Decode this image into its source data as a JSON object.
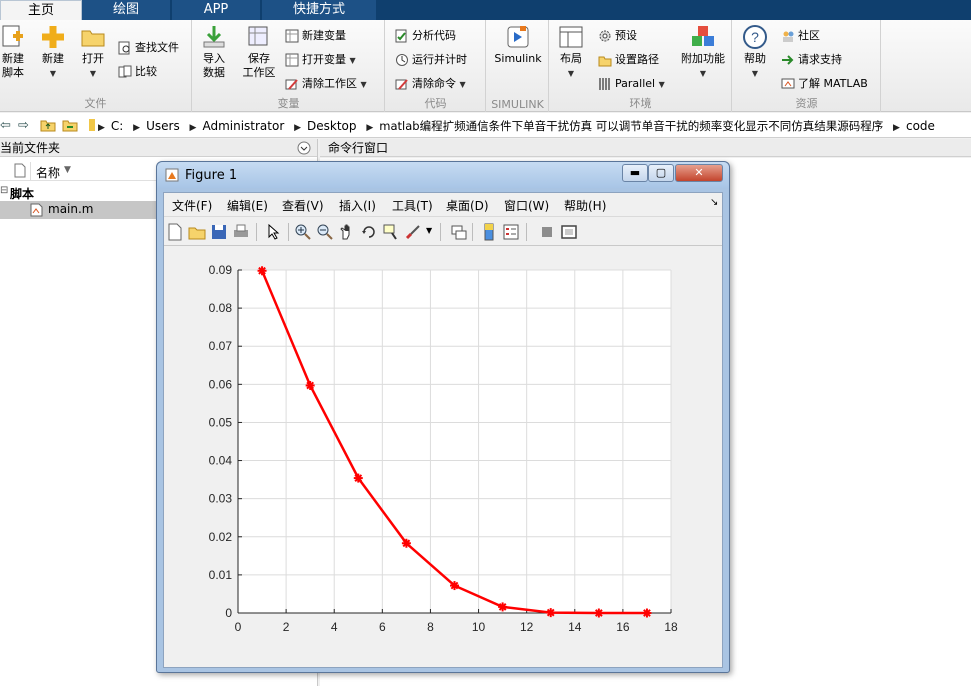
{
  "tabs": [
    "主页",
    "绘图",
    "APP",
    "快捷方式"
  ],
  "ribbon": {
    "file": {
      "new_script": "新建\n脚本",
      "new": "新建",
      "open": "打开",
      "find_files": "查找文件",
      "compare": "比较",
      "section": "文件"
    },
    "variable": {
      "import": "导入\n数据",
      "save": "保存\n工作区",
      "new_var": "新建变量",
      "open_var": "打开变量",
      "clear_ws": "清除工作区",
      "section": "变量"
    },
    "code": {
      "analyze": "分析代码",
      "run_time": "运行并计时",
      "clear_cmd": "清除命令",
      "section": "代码"
    },
    "simulink": {
      "label": "Simulink",
      "section": "SIMULINK"
    },
    "env": {
      "layout": "布局",
      "prefs": "预设",
      "setpath": "设置路径",
      "parallel": "Parallel",
      "addons": "附加功能",
      "section": "环境"
    },
    "resources": {
      "help": "帮助",
      "community": "社区",
      "support": "请求支持",
      "learn": "了解 MATLAB",
      "section": "资源"
    }
  },
  "address": {
    "path": [
      "C:",
      "Users",
      "Administrator",
      "Desktop",
      "matlab编程扩频通信条件下单音干扰仿真 可以调节单音干扰的频率变化显示不同仿真结果源码程序",
      "code"
    ]
  },
  "filepanel": {
    "title": "当前文件夹",
    "col_name": "名称",
    "group": "脚本",
    "file": "main.m"
  },
  "cmdwindow": {
    "title": "命令行窗口"
  },
  "figure": {
    "title": "Figure 1",
    "menus": [
      "文件(F)",
      "编辑(E)",
      "查看(V)",
      "插入(I)",
      "工具(T)",
      "桌面(D)",
      "窗口(W)",
      "帮助(H)"
    ]
  },
  "chart_data": {
    "type": "line",
    "title": "",
    "xlabel": "",
    "ylabel": "",
    "xlim": [
      0,
      18
    ],
    "ylim": [
      0,
      0.09
    ],
    "xticks": [
      0,
      2,
      4,
      6,
      8,
      10,
      12,
      14,
      16,
      18
    ],
    "yticks": [
      0,
      0.01,
      0.02,
      0.03,
      0.04,
      0.05,
      0.06,
      0.07,
      0.08,
      0.09
    ],
    "xtick_labels": [
      "0",
      "2",
      "4",
      "6",
      "8",
      "10",
      "12",
      "14",
      "16",
      "18"
    ],
    "ytick_labels": [
      "0",
      "0.01",
      "0.02",
      "0.03",
      "0.04",
      "0.05",
      "0.06",
      "0.07",
      "0.08",
      "0.09"
    ],
    "grid": true,
    "series": [
      {
        "x": [
          1,
          3,
          5,
          7,
          9,
          11,
          13,
          15,
          17
        ],
        "y": [
          0.0898,
          0.0597,
          0.0354,
          0.0183,
          0.0072,
          0.0016,
          0.0001,
          0.0,
          0.0
        ],
        "color": "#ff0000",
        "marker": "*"
      }
    ]
  }
}
